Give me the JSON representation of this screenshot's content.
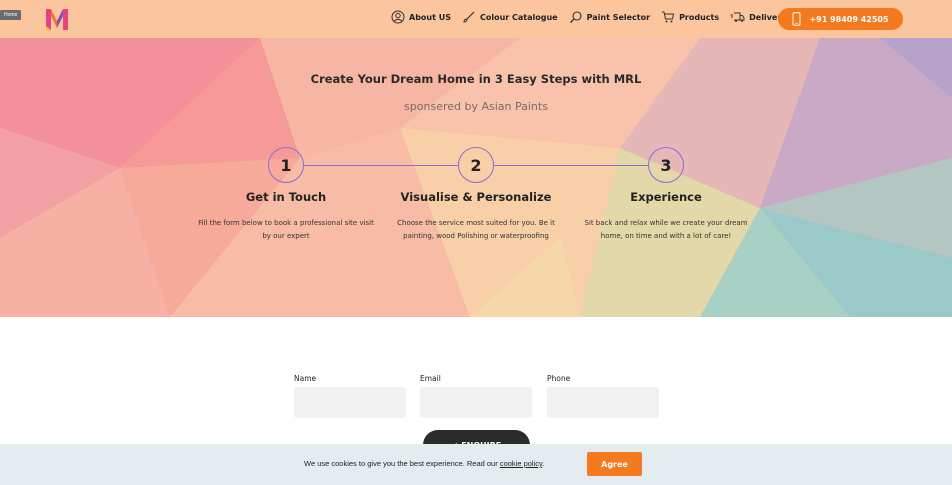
{
  "header": {
    "home_tag": "Home",
    "nav": [
      {
        "label": "About US",
        "icon": "user-circle-icon"
      },
      {
        "label": "Colour Catalogue",
        "icon": "brush-icon"
      },
      {
        "label": "Paint Selector",
        "icon": "search-icon"
      },
      {
        "label": "Products",
        "icon": "cart-icon"
      },
      {
        "label": "Deliver",
        "icon": "delivery-truck-icon"
      }
    ],
    "phone": "+91 98409 42505",
    "accent": "#f47a1f",
    "bar_color": "#fbc59e"
  },
  "hero": {
    "title": "Create Your Dream Home in 3 Easy Steps with MRL",
    "subtitle": "sponsered by Asian Paints",
    "steps": [
      {
        "number": "1",
        "title": "Get in Touch",
        "desc": "Fill the form below to book a professional site visit by our expert"
      },
      {
        "number": "2",
        "title": "Visualise & Personalize",
        "desc": "Choose the service most suited for you. Be it painting, wood Polishing or waterproofing"
      },
      {
        "number": "3",
        "title": "Experience",
        "desc": "Sit back and relax while we create your dream home, on time and with a lot of care!"
      }
    ]
  },
  "form": {
    "name_label": "Name",
    "email_label": "Email",
    "phone_label": "Phone",
    "submit_label": "✓ ENQUIRE"
  },
  "cookie": {
    "text_before": "We use cookies to give you the best experience. Read our ",
    "link": "cookie policy",
    "text_after": ".",
    "agree": "Agree"
  }
}
